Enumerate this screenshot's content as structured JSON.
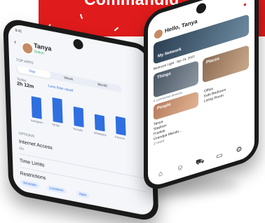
{
  "banner": {
    "title": "Commandid."
  },
  "phone_left": {
    "time": "9:41",
    "user_name": "Tanya",
    "user_status": "Online",
    "section_top_apps": "TOP APPS",
    "tabs": [
      "Day",
      "Week",
      "Month"
    ],
    "today_label": "Today",
    "today_time": "2h 12m",
    "chart_subtitle": "Less than usual",
    "chart_x_labels": [
      "Instagram",
      "TikTok",
      "Youtube",
      "Whatsapp",
      "Chrome"
    ],
    "chart_values": [
      0.78,
      0.9,
      0.72,
      0.58,
      0.66
    ],
    "options_header": "OPTIONS",
    "internet_access_label": "Internet Access",
    "internet_access_value": "On",
    "time_limits_label": "Time Limits",
    "restrictions_label": "Restrictions",
    "restriction_pills": [
      "Schedule",
      "Locations",
      "Apps"
    ]
  },
  "phone_right": {
    "greeting": "Hello, Tanya",
    "network_card": {
      "label": "My Network"
    },
    "info_text": "Bedroom Light · Apr 24, 2022",
    "things_card": {
      "label": "Things",
      "sub": "6 connected devices"
    },
    "places_card": {
      "label": "Places"
    },
    "people_card": {
      "label": "People"
    },
    "people_list": [
      "Tanya",
      "Stephen",
      "Frankie",
      "Grandpa Mendo..."
    ],
    "people_more": "2 more",
    "places_list": [
      "Office",
      "Kids Bedroom",
      "Living Room"
    ],
    "nav_icons": [
      "home-icon",
      "people-icon",
      "car-icon",
      "tv-icon",
      "gear-icon"
    ]
  }
}
